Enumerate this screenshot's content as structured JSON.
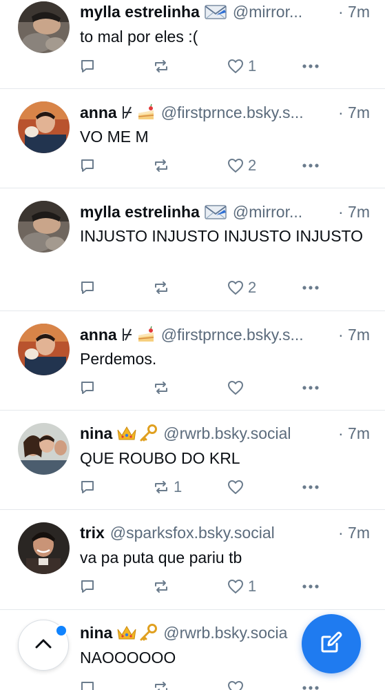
{
  "posts": [
    {
      "name": "mylla estrelinha",
      "decor": "envelope",
      "handle": "@mirror...",
      "time": "· 7m",
      "text": "to mal por eles :(",
      "likes": "1",
      "reposts": ""
    },
    {
      "name": "anna",
      "decor": "not-proves-cake",
      "handle": "@firstprnce.bsky.s...",
      "time": "· 7m",
      "text": "VO ME M",
      "likes": "2",
      "reposts": ""
    },
    {
      "name": "mylla estrelinha",
      "decor": "envelope",
      "handle": "@mirror...",
      "time": "· 7m",
      "text": "INJUSTO INJUSTO INJUSTO INJUSTO",
      "likes": "2",
      "reposts": ""
    },
    {
      "name": "anna",
      "decor": "not-proves-cake",
      "handle": "@firstprnce.bsky.s...",
      "time": "· 7m",
      "text": "Perdemos.",
      "likes": "",
      "reposts": ""
    },
    {
      "name": "nina",
      "decor": "crown-key",
      "handle": "@rwrb.bsky.social",
      "time": "· 7m",
      "text": "QUE ROUBO DO KRL",
      "likes": "",
      "reposts": "1"
    },
    {
      "name": "trix",
      "decor": "",
      "handle": "@sparksfox.bsky.social",
      "time": "· 7m",
      "text": "va pa puta que pariu tb",
      "likes": "1",
      "reposts": ""
    },
    {
      "name": "nina",
      "decor": "crown-key",
      "handle": "@rwrb.bsky.socia",
      "time": "",
      "text": "NAOOOOOO",
      "likes": "",
      "reposts": ""
    }
  ],
  "icons": {
    "reply": "reply-bubble-icon",
    "repost": "repost-arrows-icon",
    "like": "heart-icon",
    "more": "more-dots-icon",
    "scroll_top": "chevron-up-icon",
    "compose": "compose-pencil-icon"
  },
  "colors": {
    "accent": "#1f7bf0",
    "dot": "#1083fe",
    "muted": "#5b6b7c",
    "icon": "#6a7b8c",
    "divider": "#e4e8ec"
  }
}
